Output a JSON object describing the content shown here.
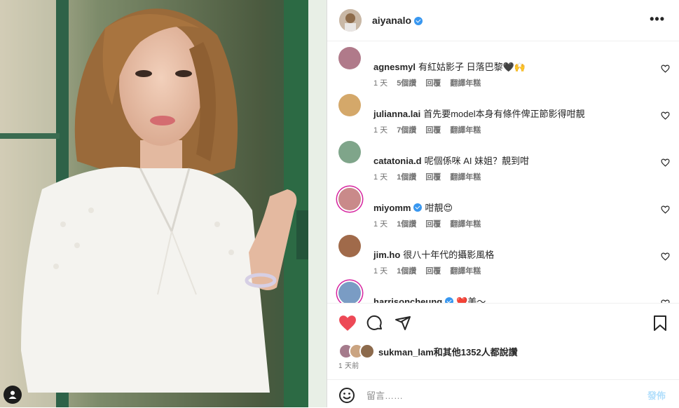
{
  "post": {
    "author": "aiyanalo",
    "author_verified": true,
    "photo_alt_icon": "user-tag-icon"
  },
  "comments": [
    {
      "user": "agnesmyl",
      "text": "有紅姑影子 日落巴黎🖤🙌",
      "age": "1 天",
      "likes": "5個讚",
      "reply": "回覆",
      "translate": "翻譯年糕",
      "verified": false
    },
    {
      "user": "julianna.lai",
      "text": "首先要model本身有條件俾正節影得咁靚",
      "age": "1 天",
      "likes": "7個讚",
      "reply": "回覆",
      "translate": "翻譯年糕",
      "verified": false
    },
    {
      "user": "catatonia.d",
      "text": "呢個係咪 AI 妹姐？靚到咁",
      "age": "1 天",
      "likes": "1個讚",
      "reply": "回覆",
      "translate": "翻譯年糕",
      "verified": false
    },
    {
      "user": "miyomm",
      "text": "咁靚😍",
      "age": "1 天",
      "likes": "1個讚",
      "reply": "回覆",
      "translate": "翻譯年糕",
      "verified": true
    },
    {
      "user": "jim.ho",
      "text": "很八十年代的攝影風格",
      "age": "1 天",
      "likes": "1個讚",
      "reply": "回覆",
      "translate": "翻譯年糕",
      "verified": false
    },
    {
      "user": "harrisoncheung",
      "text": "❤️美～",
      "age": "",
      "likes": "",
      "reply": "",
      "translate": "",
      "verified": true
    }
  ],
  "likes_summary": {
    "user": "sukman_lam",
    "rest": "和其他1352人都說讚"
  },
  "time_ago": "1 天前",
  "comment_input": {
    "placeholder": "留言……",
    "post_label": "發佈"
  },
  "colors": {
    "heart_liked": "#ed4956",
    "verified": "#3897f0",
    "meta": "#737373",
    "post_disabled": "#b2dffc"
  }
}
